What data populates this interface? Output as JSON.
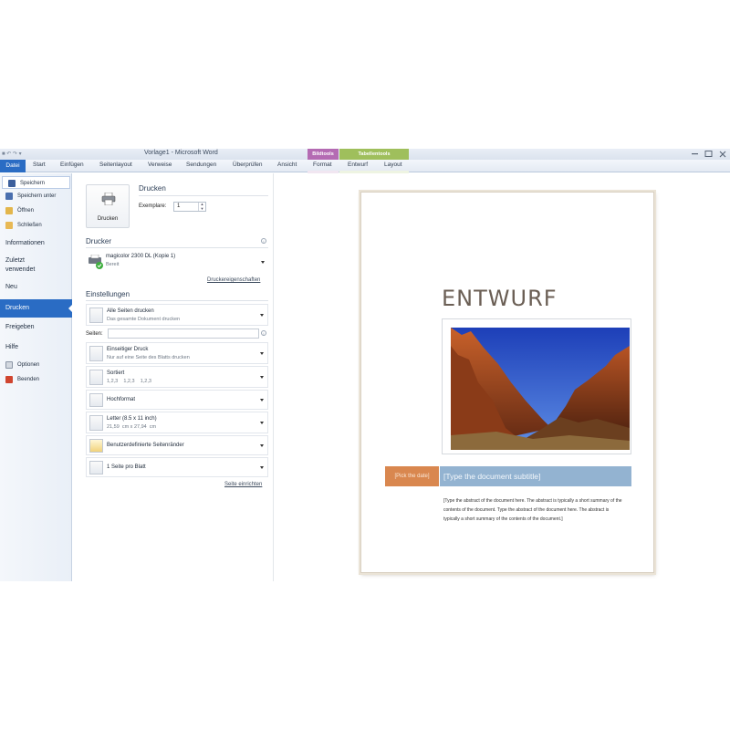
{
  "window": {
    "title": "Vorlage1 - Microsoft Word",
    "qat_text": "■ ↶ ↷ ▾",
    "context_tabs": {
      "bildtools": "Bildtools",
      "tabellentools": "Tabellentools"
    }
  },
  "ribbon": {
    "tabs": [
      "Datei",
      "Start",
      "Einfügen",
      "Seitenlayout",
      "Verweise",
      "Sendungen",
      "Überprüfen",
      "Ansicht",
      "Format",
      "Entwurf",
      "Layout"
    ]
  },
  "nav": {
    "speichern": "Speichern",
    "speichern_unter": "Speichern unter",
    "oeffnen": "Öffnen",
    "schliessen": "Schließen",
    "informationen": "Informationen",
    "zuletzt_line1": "Zuletzt",
    "zuletzt_line2": "verwendet",
    "neu": "Neu",
    "drucken": "Drucken",
    "freigeben": "Freigeben",
    "hilfe": "Hilfe",
    "optionen": "Optionen",
    "beenden": "Beenden"
  },
  "print": {
    "section_title": "Drucken",
    "button_label": "Drucken",
    "copies_label": "Exemplare:",
    "copies_value": "1",
    "printer_header": "Drucker",
    "printer_name": "magicolor 2300 DL (Kopie 1)",
    "printer_status": "Bereit",
    "printer_properties_link": "Druckereigenschaften",
    "settings_header": "Einstellungen",
    "range_main": "Alle Seiten drucken",
    "range_sub": "Das gesamte Dokument drucken",
    "pages_label": "Seiten:",
    "pages_value": "",
    "sides_main": "Einseitiger Druck",
    "sides_sub": "Nur auf eine Seite des Blatts drucken",
    "collate_main": "Sortiert",
    "collate_sub": "1,2,3    1,2,3    1,2,3",
    "orientation_main": "Hochformat",
    "paper_main": "Letter (8.5 x 11 inch)",
    "paper_sub": "21,59  cm x 27,94  cm",
    "margins_main": "Benutzerdefinierte Seitenränder",
    "persheet_main": "1 Seite pro Blatt",
    "page_setup_link": "Seite einrichten"
  },
  "document": {
    "title": "ENTWURF",
    "date_placeholder": "[Pick the date]",
    "subtitle_placeholder": "[Type the document subtitle]",
    "abstract": "[Type the abstract of the document here. The abstract is typically a short summary of the contents of the document. Type the abstract of the document here. The abstract is typically a short summary of the contents of the document.]"
  },
  "colors": {
    "accent": "#2a6cc4",
    "date_box": "#d9874f",
    "subtitle_box": "#93b3d1",
    "bildtools": "#b46bb3",
    "tabellentools": "#9fbf5c"
  }
}
